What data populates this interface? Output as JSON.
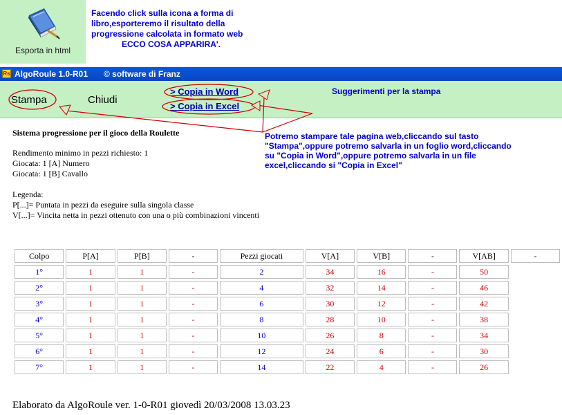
{
  "export": {
    "label": "Esporta in html",
    "note_lines": [
      "Facendo click sulla icona a forma di",
      "libro,esporteremo il risultato della",
      "progressione calcolata in formato web",
      "ECCO COSA APPARIRA'."
    ]
  },
  "window": {
    "icon_text": "Rs",
    "title": "AlgoRoule 1.0-R01",
    "copyright": "© software di Franz"
  },
  "toolbar": {
    "stampa_label": "Stampa",
    "chiudi_label": "Chiudi",
    "word_label": ">  Copia in Word",
    "excel_label": ">  Copia in Excel",
    "suggest_label": "Suggerimenti per la stampa"
  },
  "instructions": [
    "Potremo stampare tale pagina web,cliccando sul tasto",
    "\"Stampa\",oppure potremo salvarla in un foglio word,cliccando",
    "su \"Copia in Word\",oppure potremo salvarla in un file",
    "excel,cliccando si \"Copia in Excel\""
  ],
  "content": {
    "title": "Sistema progressione per il gioco della Roulette",
    "rendimento": "Rendimento minimo in pezzi richiesto: 1",
    "giocata_a": "Giocata: 1 [A] Numero",
    "giocata_b": "Giocata: 1 [B] Cavallo",
    "legenda_title": "Legenda:",
    "legenda_p": "P[...]= Puntata in pezzi da eseguire sulla singola classe",
    "legenda_v": "V[...]= Vincita netta in pezzi ottenuto con una o più combinazioni vincenti"
  },
  "table": {
    "headers": [
      "Colpo",
      "P[A]",
      "P[B]",
      "-",
      "Pezzi giocati",
      "V[A]",
      "V[B]",
      "-",
      "V[AB]",
      "-"
    ],
    "rows": [
      [
        "1°",
        "1",
        "1",
        "-",
        "2",
        "34",
        "16",
        "-",
        "50"
      ],
      [
        "2°",
        "1",
        "1",
        "-",
        "4",
        "32",
        "14",
        "-",
        "46"
      ],
      [
        "3°",
        "1",
        "1",
        "-",
        "6",
        "30",
        "12",
        "-",
        "42"
      ],
      [
        "4°",
        "1",
        "1",
        "-",
        "8",
        "28",
        "10",
        "-",
        "38"
      ],
      [
        "5°",
        "1",
        "1",
        "-",
        "10",
        "26",
        "8",
        "-",
        "34"
      ],
      [
        "6°",
        "1",
        "1",
        "-",
        "12",
        "24",
        "6",
        "-",
        "30"
      ],
      [
        "7°",
        "1",
        "1",
        "-",
        "14",
        "22",
        "4",
        "-",
        "26"
      ]
    ]
  },
  "footer": "Elaborato da AlgoRoule ver. 1-0-R01 giovedì 20/03/2008 13.03.23",
  "colors": {
    "green_panel": "#c4f0c4",
    "titlebar": "#0a50d0",
    "note_blue": "#0000cc",
    "value_red": "#d20000",
    "annotation_red": "#d00000"
  }
}
